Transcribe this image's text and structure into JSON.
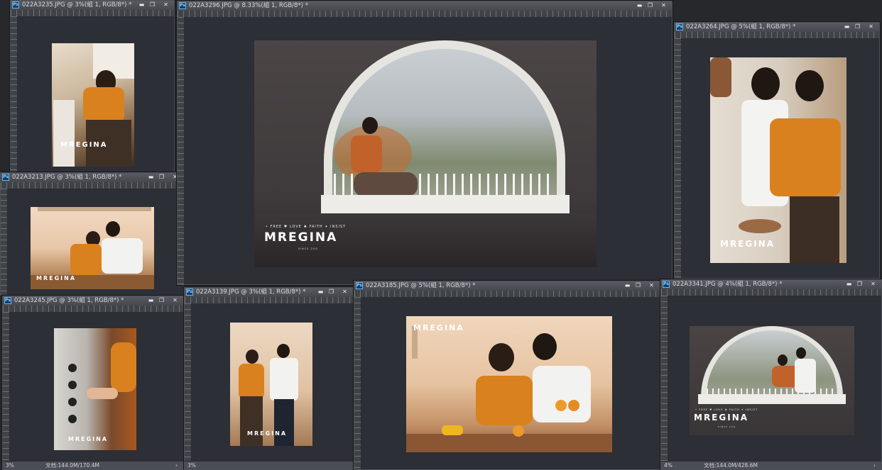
{
  "windows": [
    {
      "id": "w1",
      "title": "022A3235.JPG @ 3%(組 1, RGB/8*) *"
    },
    {
      "id": "w2",
      "title": "022A3296.JPG @ 8.33%(組 1, RGB/8*) *"
    },
    {
      "id": "w3",
      "title": "022A3264.JPG @ 5%(組 1, RGB/8*) *"
    },
    {
      "id": "w4",
      "title": "022A3213.JPG @ 3%(組 1, RGB/8*) *"
    },
    {
      "id": "w5",
      "title": "022A3245.JPG @ 3%(組 1, RGB/8*) *"
    },
    {
      "id": "w6",
      "title": "022A3139.JPG @ 3%(組 1, RGB/8*) *"
    },
    {
      "id": "w7",
      "title": "022A3185.JPG @ 5%(組 1, RGB/8*) *"
    },
    {
      "id": "w8",
      "title": "022A3341.JPG @ 4%(組 1, RGB/8*) *"
    }
  ],
  "controls": {
    "minimize": "▬",
    "maximize": "❐",
    "close": "✕"
  },
  "ps_label": "Ps",
  "watermark": {
    "brand": "MREGINA",
    "tags": "• FREE   ♥ LOVE   ♣ FAITH   ✦ INSIST",
    "since": "SINCE 20G"
  },
  "status": {
    "left_zoom": "3%",
    "mid_zoom": "3%",
    "right_zoom": "4%",
    "doc_left": "文档:144.0M/170.4M",
    "doc_right": "文档:144.0M/428.6M",
    "arrow": "›"
  },
  "icons": {
    "ps": "photoshop-icon",
    "minimize": "minimize-icon",
    "maximize": "maximize-icon",
    "close": "close-icon"
  }
}
